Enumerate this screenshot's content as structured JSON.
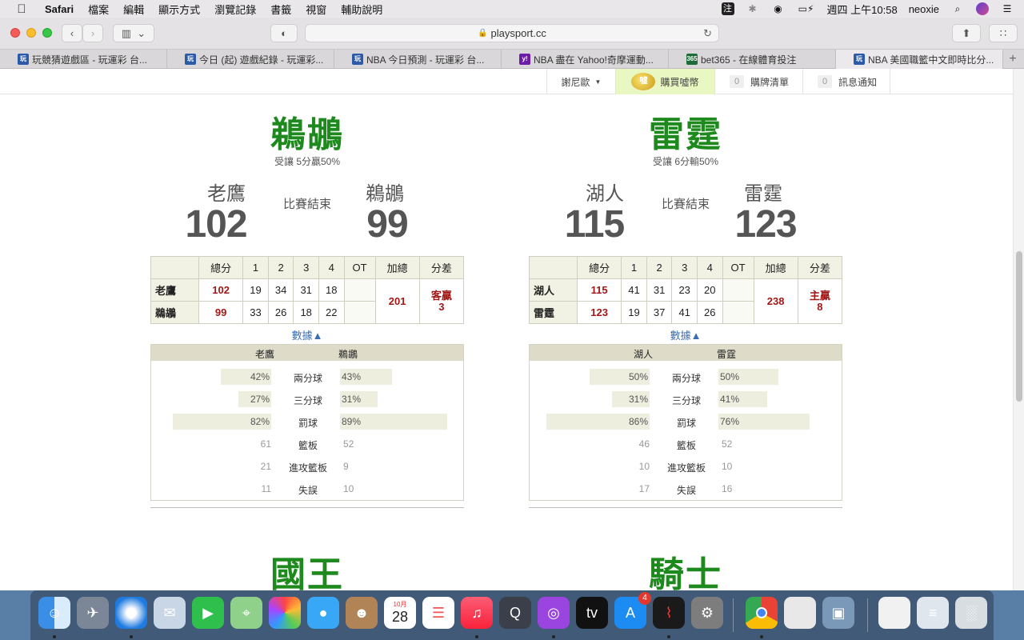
{
  "menubar": {
    "app": "Safari",
    "items": [
      "檔案",
      "編輯",
      "顯示方式",
      "瀏覽記錄",
      "書籤",
      "視窗",
      "輔助說明"
    ],
    "input_method": "注",
    "clock": "週四 上午10:58",
    "user": "neoxie"
  },
  "browser": {
    "url": "playsport.cc",
    "tabs": [
      {
        "title": "玩競猜遊戲區 - 玩運彩 台...",
        "fav": "玩",
        "color": "#2b5aa8"
      },
      {
        "title": "今日 (起) 遊戲紀錄 - 玩運彩...",
        "fav": "玩",
        "color": "#2b5aa8"
      },
      {
        "title": "NBA 今日預測 - 玩運彩 台...",
        "fav": "玩",
        "color": "#2b5aa8"
      },
      {
        "title": "NBA 盡在 Yahoo!奇摩運動...",
        "fav": "y!",
        "color": "#6d1ca8"
      },
      {
        "title": "bet365 - 在線體育投注",
        "fav": "365",
        "color": "#1e6b3a"
      },
      {
        "title": "NBA 美國職籃中文即時比分...",
        "fav": "玩",
        "color": "#2b5aa8"
      }
    ]
  },
  "topnav": {
    "user": "謝尼歐",
    "buy_label": "購買噓幣",
    "coin_text": "噓",
    "cart_label": "購牌清單",
    "cart_count": "0",
    "notice_label": "訊息通知",
    "notice_count": "0"
  },
  "games": [
    {
      "title": "鵜鶘",
      "subtitle": "受讓 5分贏50%",
      "status": "比賽結束",
      "away": {
        "name": "老鷹",
        "score": "102",
        "quarters": [
          "19",
          "34",
          "31",
          "18"
        ],
        "total": "102"
      },
      "home": {
        "name": "鵜鶘",
        "score": "99",
        "quarters": [
          "33",
          "26",
          "18",
          "22"
        ],
        "total": "99"
      },
      "headers": [
        "總分",
        "1",
        "2",
        "3",
        "4",
        "OT",
        "加總",
        "分差"
      ],
      "sum": "201",
      "diff_label": "客贏",
      "diff_value": "3",
      "data_link": "數據▲",
      "stats": [
        {
          "label": "兩分球",
          "left": "42%",
          "right": "43%",
          "lfrac": 0.42,
          "rfrac": 0.43,
          "bar": true
        },
        {
          "label": "三分球",
          "left": "27%",
          "right": "31%",
          "lfrac": 0.27,
          "rfrac": 0.31,
          "bar": true
        },
        {
          "label": "罰球",
          "left": "82%",
          "right": "89%",
          "lfrac": 0.82,
          "rfrac": 0.89,
          "bar": true
        },
        {
          "label": "籃板",
          "left": "61",
          "right": "52",
          "bar": false
        },
        {
          "label": "進攻籃板",
          "left": "21",
          "right": "9",
          "bar": false
        },
        {
          "label": "失誤",
          "left": "11",
          "right": "10",
          "bar": false
        }
      ]
    },
    {
      "title": "雷霆",
      "subtitle": "受讓 6分輸50%",
      "status": "比賽結束",
      "away": {
        "name": "湖人",
        "score": "115",
        "quarters": [
          "41",
          "31",
          "23",
          "20"
        ],
        "total": "115"
      },
      "home": {
        "name": "雷霆",
        "score": "123",
        "quarters": [
          "19",
          "37",
          "41",
          "26"
        ],
        "total": "123"
      },
      "headers": [
        "總分",
        "1",
        "2",
        "3",
        "4",
        "OT",
        "加總",
        "分差"
      ],
      "sum": "238",
      "diff_label": "主贏",
      "diff_value": "8",
      "data_link": "數據▲",
      "stats": [
        {
          "label": "兩分球",
          "left": "50%",
          "right": "50%",
          "lfrac": 0.5,
          "rfrac": 0.5,
          "bar": true
        },
        {
          "label": "三分球",
          "left": "31%",
          "right": "41%",
          "lfrac": 0.31,
          "rfrac": 0.41,
          "bar": true
        },
        {
          "label": "罰球",
          "left": "86%",
          "right": "76%",
          "lfrac": 0.86,
          "rfrac": 0.76,
          "bar": true
        },
        {
          "label": "籃板",
          "left": "46",
          "right": "52",
          "bar": false
        },
        {
          "label": "進攻籃板",
          "left": "10",
          "right": "10",
          "bar": false
        },
        {
          "label": "失誤",
          "left": "17",
          "right": "16",
          "bar": false
        }
      ]
    }
  ],
  "next_games": [
    "國王",
    "騎士"
  ],
  "dock": {
    "calendar_month": "10月",
    "calendar_day": "28",
    "appstore_badge": "4",
    "icons": [
      "finder-icon",
      "launchpad-icon",
      "safari-icon",
      "preview-icon",
      "facetime-icon",
      "maps-icon",
      "photos-icon",
      "messages-icon",
      "contacts-icon",
      "calendar-icon",
      "reminders-icon",
      "music-icon",
      "quicktime-icon",
      "podcasts-icon",
      "tv-icon",
      "appstore-icon",
      "voicememos-icon",
      "system-preferences-icon",
      "chrome-icon",
      "document-icon",
      "image-viewer-icon",
      "file-icon",
      "finder-window-icon",
      "trash-icon"
    ]
  }
}
